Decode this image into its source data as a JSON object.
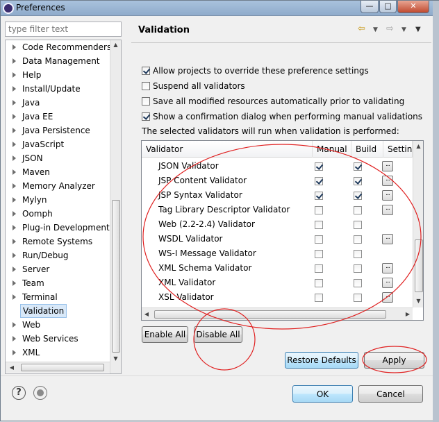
{
  "window": {
    "title": "Preferences"
  },
  "filter": {
    "placeholder": "type filter text"
  },
  "tree": {
    "items": [
      {
        "label": "Code Recommenders"
      },
      {
        "label": "Data Management"
      },
      {
        "label": "Help"
      },
      {
        "label": "Install/Update"
      },
      {
        "label": "Java"
      },
      {
        "label": "Java EE"
      },
      {
        "label": "Java Persistence"
      },
      {
        "label": "JavaScript"
      },
      {
        "label": "JSON"
      },
      {
        "label": "Maven"
      },
      {
        "label": "Memory Analyzer"
      },
      {
        "label": "Mylyn"
      },
      {
        "label": "Oomph"
      },
      {
        "label": "Plug-in Development"
      },
      {
        "label": "Remote Systems"
      },
      {
        "label": "Run/Debug"
      },
      {
        "label": "Server"
      },
      {
        "label": "Team"
      },
      {
        "label": "Terminal"
      },
      {
        "label": "Validation",
        "selected": true
      },
      {
        "label": "Web"
      },
      {
        "label": "Web Services"
      },
      {
        "label": "XML"
      }
    ]
  },
  "pane": {
    "title": "Validation",
    "options": [
      {
        "label": "Allow projects to override these preference settings",
        "checked": true
      },
      {
        "label": "Suspend all validators",
        "checked": false
      },
      {
        "label": "Save all modified resources automatically prior to validating",
        "checked": false
      },
      {
        "label": "Show a confirmation dialog when performing manual validations",
        "checked": true
      }
    ],
    "info": "The selected validators will run when validation is performed:",
    "columns": [
      "Validator",
      "Manual",
      "Build",
      "Settings"
    ],
    "rows": [
      {
        "name": "JSON Validator",
        "manual": true,
        "build": true,
        "settings": true
      },
      {
        "name": "JSP Content Validator",
        "manual": true,
        "build": true,
        "settings": true
      },
      {
        "name": "JSP Syntax Validator",
        "manual": true,
        "build": true,
        "settings": true
      },
      {
        "name": "Tag Library Descriptor Validator",
        "manual": false,
        "build": false,
        "settings": true
      },
      {
        "name": "Web (2.2-2.4) Validator",
        "manual": false,
        "build": false,
        "settings": false
      },
      {
        "name": "WSDL Validator",
        "manual": false,
        "build": false,
        "settings": true
      },
      {
        "name": "WS-I Message Validator",
        "manual": false,
        "build": false,
        "settings": false
      },
      {
        "name": "XML Schema Validator",
        "manual": false,
        "build": false,
        "settings": true
      },
      {
        "name": "XML Validator",
        "manual": false,
        "build": false,
        "settings": true
      },
      {
        "name": "XSL Validator",
        "manual": false,
        "build": false,
        "settings": true
      }
    ],
    "settings_btn": "...",
    "enable_all": "Enable All",
    "disable_all": "Disable All",
    "restore_defaults": "Restore Defaults",
    "apply": "Apply"
  },
  "footer": {
    "ok": "OK",
    "cancel": "Cancel",
    "help_glyph": "?"
  },
  "titlebar_buttons": {
    "minimize": "—",
    "maximize": "□",
    "close": "✕"
  },
  "annotation_color": "#e02020"
}
